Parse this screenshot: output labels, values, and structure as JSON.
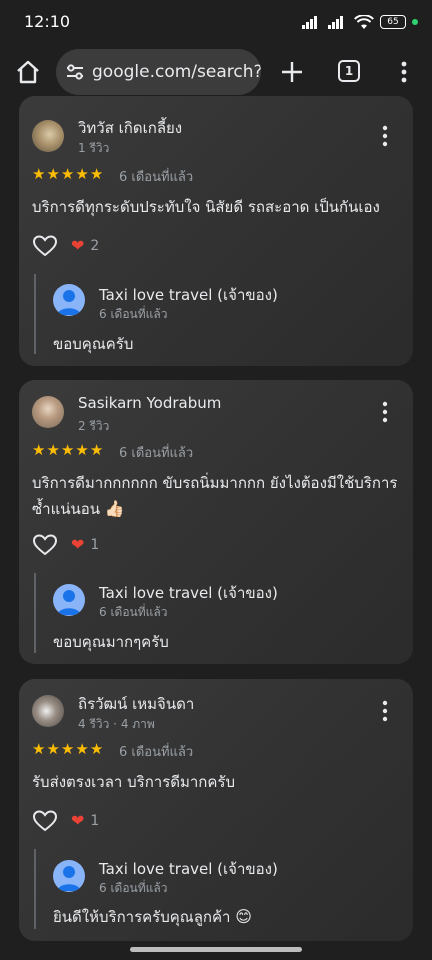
{
  "status_bar": {
    "time": "12:10",
    "battery": "65"
  },
  "browser": {
    "url": "google.com/search?q",
    "tab_count": "1"
  },
  "reviews": [
    {
      "name": "วิทวัส เกิดเกลี้ยง",
      "meta": "1 รีวิว",
      "rating": 5,
      "time": "6 เดือนที่แล้ว",
      "text": "บริการดีทุกระดับประทับใจ นิสัยดี รถสะอาด เป็นกันเอง",
      "text_emoji": "",
      "likes": "2",
      "reply": {
        "owner": "Taxi love travel (เจ้าของ)",
        "time": "6 เดือนที่แล้ว",
        "text": "ขอบคุณครับ",
        "emoji": ""
      }
    },
    {
      "name": "Sasikarn Yodrabum",
      "meta": "2 รีวิว",
      "rating": 5,
      "time": "6 เดือนที่แล้ว",
      "text": "บริการดีมากกกกกก ขับรถนิ่มมากกก ยังไงต้องมีใช้บริการซ้ำแน่นอน",
      "text_emoji": "👍🏻",
      "likes": "1",
      "reply": {
        "owner": "Taxi love travel (เจ้าของ)",
        "time": "6 เดือนที่แล้ว",
        "text": "ขอบคุณมากๆครับ",
        "emoji": ""
      }
    },
    {
      "name": "ถิรวัฒน์ เหมจินดา",
      "meta": "4 รีวิว · 4 ภาพ",
      "rating": 5,
      "time": "6 เดือนที่แล้ว",
      "text": "รับส่งตรงเวลา บริการดีมากครับ",
      "text_emoji": "",
      "likes": "1",
      "reply": {
        "owner": "Taxi love travel (เจ้าของ)",
        "time": "6 เดือนที่แล้ว",
        "text": "ยินดีให้บริการครับคุณลูกค้า",
        "emoji": "😊"
      }
    }
  ],
  "colors": {
    "star": "#fbbc04",
    "heart": "#ea4335",
    "owner_avatar": "#8ab4f8",
    "card_bg": "#353535",
    "page_bg": "#1f1f1f"
  }
}
